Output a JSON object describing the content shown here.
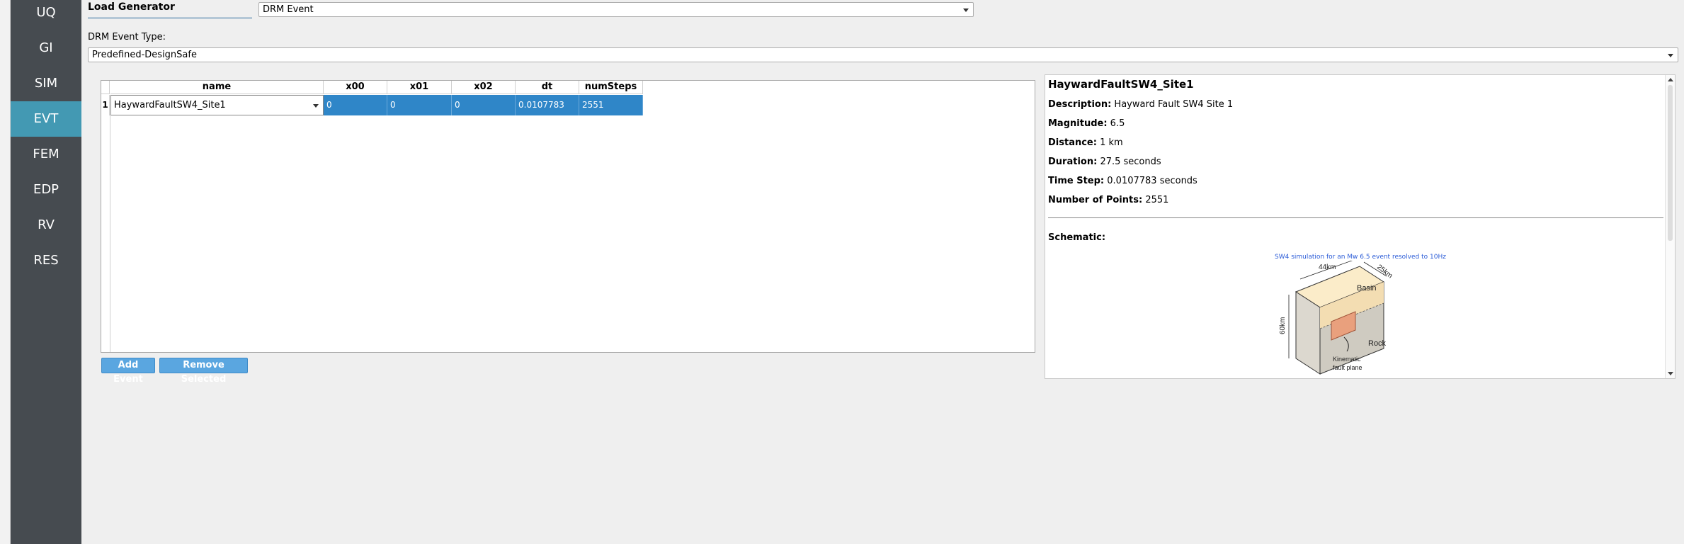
{
  "sidebar": {
    "items": [
      {
        "label": "UQ",
        "active": false
      },
      {
        "label": "GI",
        "active": false
      },
      {
        "label": "SIM",
        "active": false
      },
      {
        "label": "EVT",
        "active": true
      },
      {
        "label": "FEM",
        "active": false
      },
      {
        "label": "EDP",
        "active": false
      },
      {
        "label": "RV",
        "active": false
      },
      {
        "label": "RES",
        "active": false
      }
    ]
  },
  "header": {
    "title": "Load Generator",
    "generator_value": "DRM Event"
  },
  "drm_type": {
    "label": "DRM Event Type:",
    "value": "Predefined-DesignSafe"
  },
  "table": {
    "columns": [
      "name",
      "x00",
      "x01",
      "x02",
      "dt",
      "numSteps"
    ],
    "rows": [
      {
        "index": "1",
        "name": "HaywardFaultSW4_Site1",
        "x00": "0",
        "x01": "0",
        "x02": "0",
        "dt": "0.0107783",
        "numSteps": "2551"
      }
    ]
  },
  "buttons": {
    "add": "Add Event",
    "remove": "Remove Selected"
  },
  "info": {
    "title": "HaywardFaultSW4_Site1",
    "description_label": "Description:",
    "description": "Hayward Fault SW4 Site 1",
    "magnitude_label": "Magnitude:",
    "magnitude": "6.5",
    "distance_label": "Distance:",
    "distance": "1 km",
    "duration_label": "Duration:",
    "duration": "27.5 seconds",
    "timestep_label": "Time Step:",
    "timestep": "0.0107783 seconds",
    "points_label": "Number of Points:",
    "points": "2551",
    "schematic_label": "Schematic:",
    "schematic": {
      "caption": "SW4 simulation for an Mw 6.5 event resolved to 10Hz",
      "dim_x": "44km",
      "dim_y": "25km",
      "dim_z": "60km",
      "label_basin": "Basin",
      "label_rock": "Rock",
      "label_fault_1": "Kinematic",
      "label_fault_2": "fault plane"
    }
  },
  "colors": {
    "sidebar_bg": "#464b50",
    "sidebar_active": "#4399b3",
    "selection": "#2f86c8",
    "button": "#5aa6e0"
  }
}
